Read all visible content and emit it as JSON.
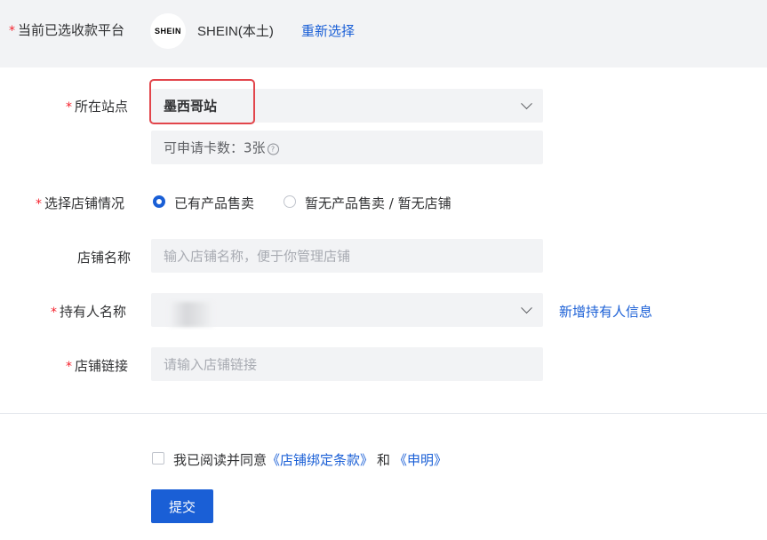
{
  "platform": {
    "label": "当前已选收款平台",
    "logo_text": "SHEIN",
    "name": "SHEIN(本土)",
    "reselect_label": "重新选择"
  },
  "form": {
    "required_mark": "*",
    "site": {
      "label": "所在站点",
      "value": "墨西哥站",
      "card_count_text": "可申请卡数：3张",
      "help_glyph": "?"
    },
    "shop_status": {
      "label": "选择店铺情况",
      "options": [
        {
          "label": "已有产品售卖",
          "checked": true
        },
        {
          "label": "暂无产品售卖 / 暂无店铺",
          "checked": false
        }
      ]
    },
    "shop_name": {
      "label": "店铺名称",
      "placeholder": "输入店铺名称，便于你管理店铺"
    },
    "holder": {
      "label": "持有人名称",
      "value": "",
      "add_link": "新增持有人信息"
    },
    "shop_link": {
      "label": "店铺链接",
      "placeholder": "请输入店铺链接"
    }
  },
  "agreement": {
    "prefix": "我已阅读并同意",
    "terms_link": "《店铺绑定条款》",
    "conjunction": "和",
    "statement_link": "《申明》",
    "checked": false
  },
  "submit_label": "提交",
  "colors": {
    "accent": "#1a5fd6",
    "required": "#f5222d",
    "highlight": "#e2454b",
    "field_bg": "#f2f3f5"
  }
}
